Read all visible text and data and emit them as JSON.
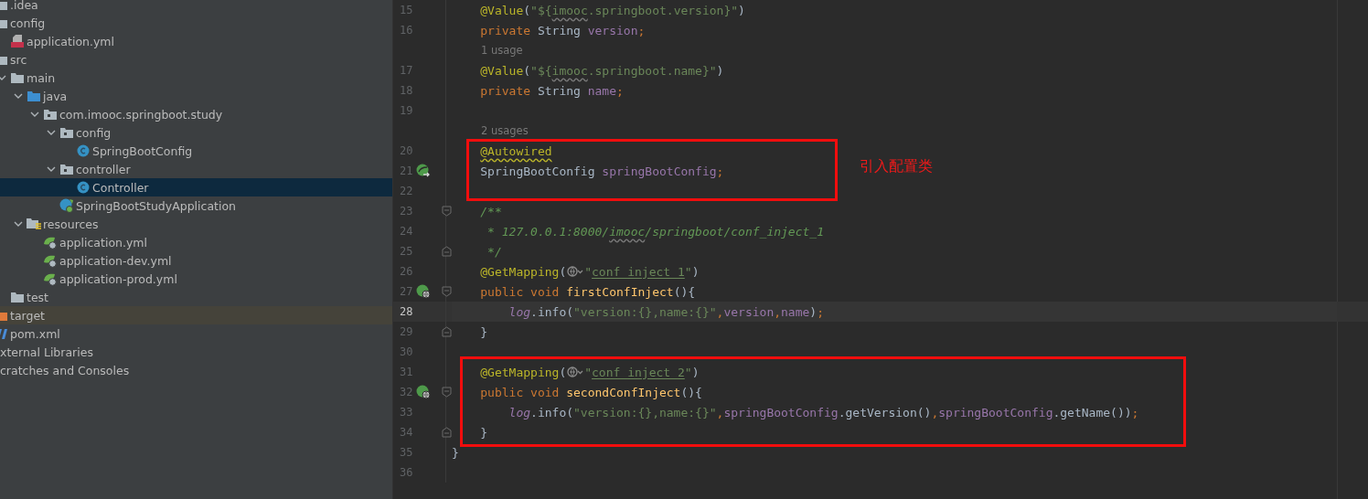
{
  "project_tree": [
    {
      "label": ".idea",
      "kind": "folder",
      "selected": false
    },
    {
      "label": "config",
      "kind": "folder",
      "selected": false,
      "children": [
        {
          "label": "application.yml",
          "kind": "yml",
          "selected": false
        }
      ]
    },
    {
      "label": "src",
      "kind": "folder",
      "selected": false,
      "children": [
        {
          "label": "main",
          "kind": "folder",
          "selected": false,
          "expanded": true,
          "children": [
            {
              "label": "java",
              "kind": "source-folder",
              "selected": false,
              "expanded": true,
              "children": [
                {
                  "label": "com.imooc.springboot.study",
                  "kind": "package",
                  "selected": false,
                  "expanded": true,
                  "children": [
                    {
                      "label": "config",
                      "kind": "package",
                      "selected": false,
                      "expanded": true,
                      "children": [
                        {
                          "label": "SpringBootConfig",
                          "kind": "class",
                          "selected": false
                        }
                      ]
                    },
                    {
                      "label": "controller",
                      "kind": "package",
                      "selected": false,
                      "expanded": true,
                      "children": [
                        {
                          "label": "Controller",
                          "kind": "class",
                          "selected": true
                        }
                      ]
                    },
                    {
                      "label": "SpringBootStudyApplication",
                      "kind": "spring-class",
                      "selected": false
                    }
                  ]
                }
              ]
            },
            {
              "label": "resources",
              "kind": "resources-folder",
              "selected": false,
              "expanded": true,
              "children": [
                {
                  "label": "application.yml",
                  "kind": "spring-yml",
                  "selected": false
                },
                {
                  "label": "application-dev.yml",
                  "kind": "spring-yml",
                  "selected": false
                },
                {
                  "label": "application-prod.yml",
                  "kind": "spring-yml",
                  "selected": false
                }
              ]
            }
          ]
        },
        {
          "label": "test",
          "kind": "folder",
          "selected": false
        }
      ]
    },
    {
      "label": "target",
      "kind": "excluded-folder",
      "selected": false
    },
    {
      "label": "pom.xml",
      "kind": "maven",
      "selected": false
    },
    {
      "label": "xternal Libraries",
      "kind": "cut",
      "selected": false
    },
    {
      "label": "cratches and Consoles",
      "kind": "cut",
      "selected": false
    }
  ],
  "editor": {
    "lines": [
      {
        "kind": "member-line",
        "number": "15",
        "current": false,
        "tokens": [
          {
            "kind": "annotation",
            "text": "@Value"
          },
          {
            "kind": "plain",
            "text": "("
          },
          {
            "kind": "string",
            "text": "\"${"
          },
          {
            "kind": "string-typo",
            "text": "imooc"
          },
          {
            "kind": "string",
            "text": ".springboot.version}\""
          },
          {
            "kind": "plain",
            "text": ")"
          }
        ]
      },
      {
        "kind": "member-line",
        "number": "16",
        "current": false,
        "tokens": [
          {
            "kind": "keyword",
            "text": "private "
          },
          {
            "kind": "plain",
            "text": "String "
          },
          {
            "kind": "field",
            "text": "version"
          },
          {
            "kind": "keyword",
            "text": ";"
          }
        ]
      },
      {
        "kind": "hint",
        "text": "1 usage"
      },
      {
        "kind": "member-line",
        "number": "17",
        "current": false,
        "tokens": [
          {
            "kind": "annotation",
            "text": "@Value"
          },
          {
            "kind": "plain",
            "text": "("
          },
          {
            "kind": "string",
            "text": "\"${"
          },
          {
            "kind": "string-typo",
            "text": "imooc"
          },
          {
            "kind": "string",
            "text": ".springboot.name}\""
          },
          {
            "kind": "plain",
            "text": ")"
          }
        ]
      },
      {
        "kind": "member-line",
        "number": "18",
        "current": false,
        "tokens": [
          {
            "kind": "keyword",
            "text": "private "
          },
          {
            "kind": "plain",
            "text": "String "
          },
          {
            "kind": "field",
            "text": "name"
          },
          {
            "kind": "keyword",
            "text": ";"
          }
        ]
      },
      {
        "kind": "top-line",
        "number": "19",
        "current": false
      },
      {
        "kind": "hint",
        "text": "2 usages"
      },
      {
        "kind": "member-line",
        "number": "20",
        "current": false,
        "tokens": [
          {
            "kind": "annotation-warn",
            "text": "@Autowired"
          }
        ]
      },
      {
        "kind": "member-line",
        "number": "21",
        "current": false,
        "gutter": {
          "kind": "bean"
        },
        "tokens": [
          {
            "kind": "plain",
            "text": "SpringBootConfig "
          },
          {
            "kind": "field",
            "text": "springBootConfig"
          },
          {
            "kind": "keyword",
            "text": ";"
          }
        ]
      },
      {
        "kind": "top-line",
        "number": "22",
        "current": false
      },
      {
        "kind": "member-line",
        "number": "23",
        "current": false,
        "fold": {
          "kind": "start"
        },
        "tokens": [
          {
            "kind": "comment",
            "text": "/**"
          }
        ]
      },
      {
        "kind": "member-line",
        "number": "24",
        "current": false,
        "tokens": [
          {
            "kind": "comment",
            "text": " * 127.0.0.1:8000/"
          },
          {
            "kind": "comment-typo",
            "text": "imooc"
          },
          {
            "kind": "comment",
            "text": "/springboot/conf_inject_1"
          }
        ]
      },
      {
        "kind": "member-line",
        "number": "25",
        "current": false,
        "fold": {
          "kind": "end"
        },
        "tokens": [
          {
            "kind": "comment",
            "text": " */"
          }
        ]
      },
      {
        "kind": "member-line",
        "number": "26",
        "current": false,
        "tokens": [
          {
            "kind": "annotation",
            "text": "@GetMapping"
          },
          {
            "kind": "plain",
            "text": "("
          },
          {
            "kind": "web-icon"
          },
          {
            "kind": "string",
            "text": "\""
          },
          {
            "kind": "string-link",
            "text": "conf_inject_1"
          },
          {
            "kind": "string",
            "text": "\""
          },
          {
            "kind": "plain",
            "text": ")"
          }
        ]
      },
      {
        "kind": "member-line",
        "number": "27",
        "current": false,
        "gutter": {
          "kind": "endpoint"
        },
        "fold": {
          "kind": "start"
        },
        "tokens": [
          {
            "kind": "keyword",
            "text": "public void "
          },
          {
            "kind": "method",
            "text": "firstConfInject"
          },
          {
            "kind": "plain",
            "text": "(){"
          }
        ]
      },
      {
        "kind": "body-line",
        "number": "28",
        "current": true,
        "tokens": [
          {
            "kind": "static",
            "text": "log"
          },
          {
            "kind": "plain",
            "text": ".info("
          },
          {
            "kind": "string",
            "text": "\"version:{},name:{}\""
          },
          {
            "kind": "keyword",
            "text": ","
          },
          {
            "kind": "field",
            "text": "version"
          },
          {
            "kind": "keyword",
            "text": ","
          },
          {
            "kind": "field",
            "text": "name"
          },
          {
            "kind": "plain",
            "text": ")"
          },
          {
            "kind": "keyword",
            "text": ";"
          }
        ]
      },
      {
        "kind": "member-line",
        "number": "29",
        "current": false,
        "fold": {
          "kind": "end"
        },
        "tokens": [
          {
            "kind": "plain",
            "text": "}"
          }
        ]
      },
      {
        "kind": "top-line",
        "number": "30",
        "current": false
      },
      {
        "kind": "member-line",
        "number": "31",
        "current": false,
        "tokens": [
          {
            "kind": "annotation",
            "text": "@GetMapping"
          },
          {
            "kind": "plain",
            "text": "("
          },
          {
            "kind": "web-icon"
          },
          {
            "kind": "string",
            "text": "\""
          },
          {
            "kind": "string-link",
            "text": "conf_inject_2"
          },
          {
            "kind": "string",
            "text": "\""
          },
          {
            "kind": "plain",
            "text": ")"
          }
        ]
      },
      {
        "kind": "member-line",
        "number": "32",
        "current": false,
        "gutter": {
          "kind": "endpoint"
        },
        "fold": {
          "kind": "start"
        },
        "tokens": [
          {
            "kind": "keyword",
            "text": "public void "
          },
          {
            "kind": "method",
            "text": "secondConfInject"
          },
          {
            "kind": "plain",
            "text": "(){"
          }
        ]
      },
      {
        "kind": "body-line",
        "number": "33",
        "current": false,
        "tokens": [
          {
            "kind": "static",
            "text": "log"
          },
          {
            "kind": "plain",
            "text": ".info("
          },
          {
            "kind": "string",
            "text": "\"version:{},name:{}\""
          },
          {
            "kind": "keyword",
            "text": ","
          },
          {
            "kind": "field",
            "text": "springBootConfig"
          },
          {
            "kind": "plain",
            "text": ".getVersion()"
          },
          {
            "kind": "keyword",
            "text": ","
          },
          {
            "kind": "field",
            "text": "springBootConfig"
          },
          {
            "kind": "plain",
            "text": ".getName())"
          },
          {
            "kind": "keyword",
            "text": ";"
          }
        ]
      },
      {
        "kind": "member-line",
        "number": "34",
        "current": false,
        "fold": {
          "kind": "end"
        },
        "tokens": [
          {
            "kind": "plain",
            "text": "}"
          }
        ]
      },
      {
        "kind": "top-line",
        "number": "35",
        "current": false,
        "tokens": [
          {
            "kind": "plain",
            "text": "}"
          }
        ]
      },
      {
        "kind": "top-line",
        "number": "36",
        "current": false
      }
    ],
    "annotations": [
      {
        "kind": "box",
        "note": "引入配置类"
      },
      {
        "kind": "box"
      }
    ]
  }
}
